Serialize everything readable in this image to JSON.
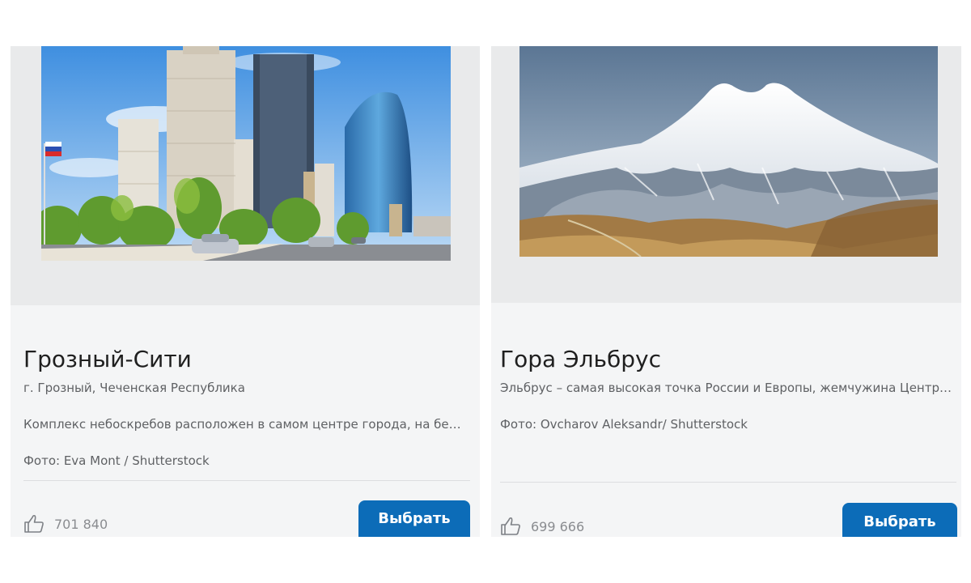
{
  "cards": [
    {
      "title": "Грозный-Сити",
      "subtitle": "г. Грозный, Чеченская Республика",
      "description": "Комплекс небоскребов расположен в самом центре города, на берегу реки Сунжи",
      "credit": "Фото: Eva Mont / Shutterstock",
      "likes": "701 840",
      "button_label": "Выбрать",
      "photo_icon": "city-skyscrapers-photo"
    },
    {
      "title": "Гора Эльбрус",
      "subtitle": "Эльбрус – самая высокая точка России и Европы, жемчужина Центрального Кавказа",
      "credit": "Фото: Ovcharov Aleksandr/ Shutterstock",
      "likes": "699 666",
      "button_label": "Выбрать",
      "photo_icon": "mountain-photo"
    }
  ],
  "colors": {
    "accent": "#0c6cb8",
    "card_background": "#f4f5f6",
    "media_background": "#e9eaeb"
  }
}
